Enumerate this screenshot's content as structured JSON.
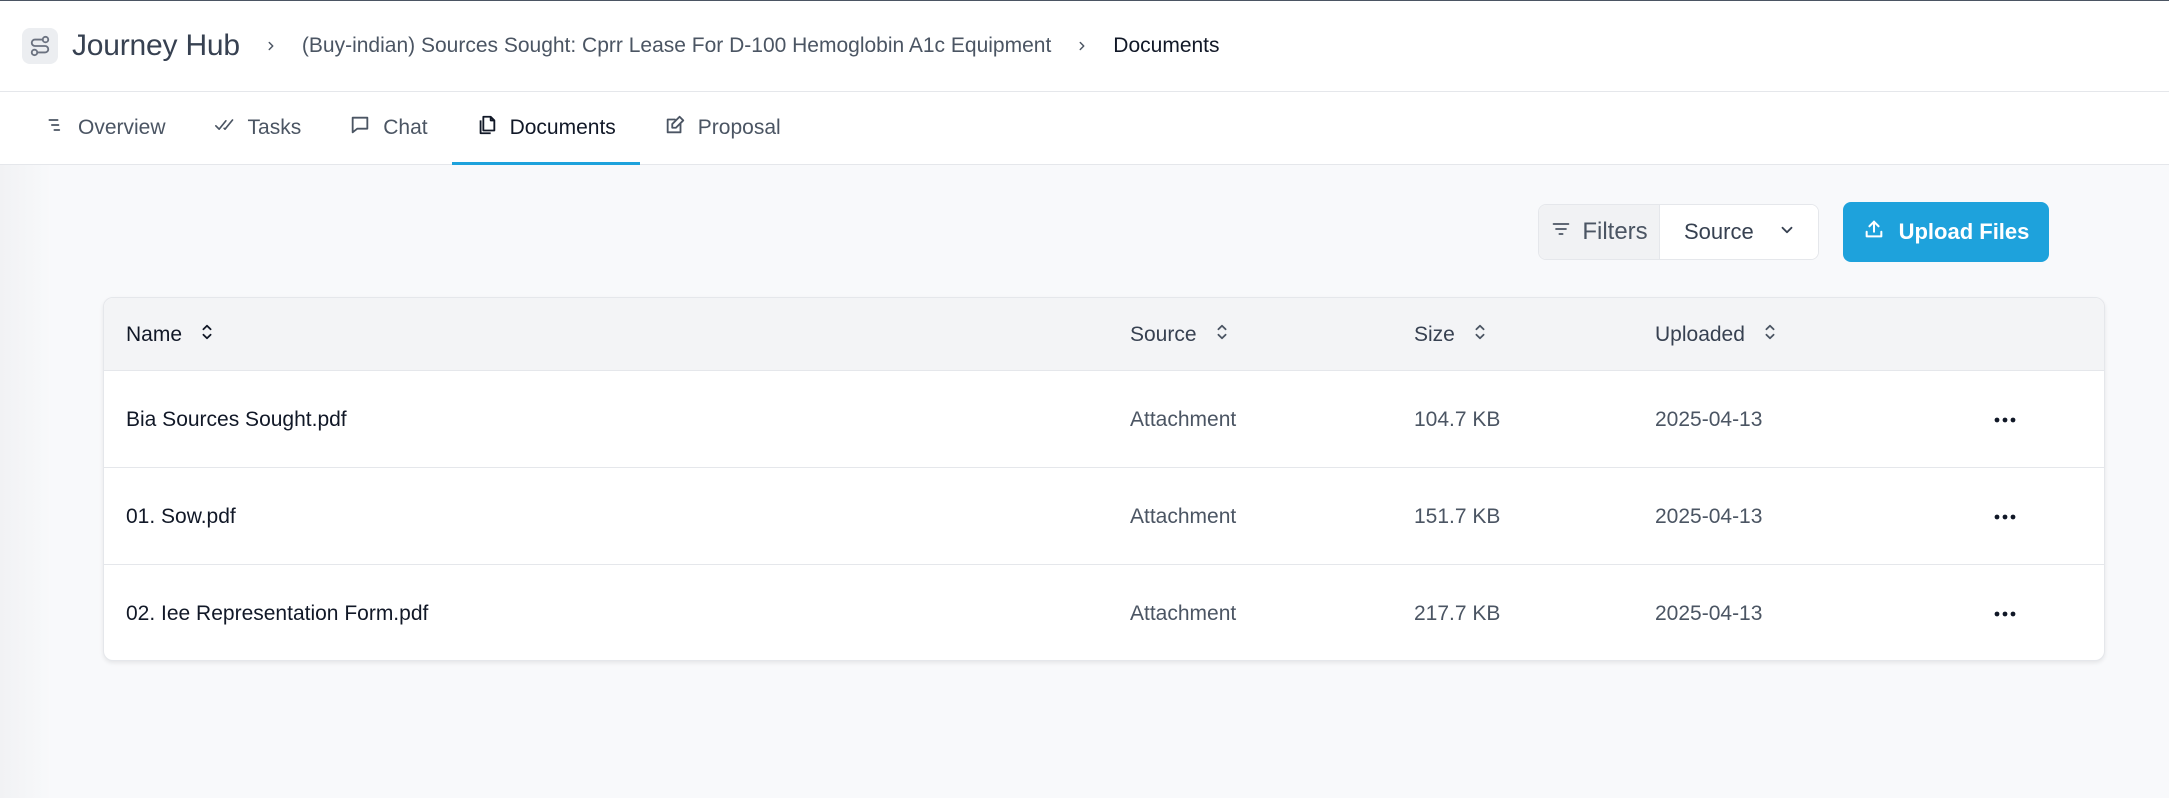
{
  "header": {
    "app_title": "Journey Hub",
    "breadcrumbs": [
      {
        "label": "(Buy-indian) Sources Sought: Cprr Lease For D-100 Hemoglobin A1c Equipment"
      },
      {
        "label": "Documents"
      }
    ]
  },
  "tabs": [
    {
      "label": "Overview",
      "icon": "list-icon"
    },
    {
      "label": "Tasks",
      "icon": "double-check-icon"
    },
    {
      "label": "Chat",
      "icon": "chat-bubble-icon"
    },
    {
      "label": "Documents",
      "icon": "documents-icon",
      "active": true
    },
    {
      "label": "Proposal",
      "icon": "edit-document-icon"
    }
  ],
  "toolbar": {
    "filters_label": "Filters",
    "source_select_value": "Source",
    "upload_label": "Upload Files"
  },
  "table": {
    "columns": [
      "Name",
      "Source",
      "Size",
      "Uploaded"
    ],
    "rows": [
      {
        "name": "Bia Sources Sought.pdf",
        "source": "Attachment",
        "size": "104.7 KB",
        "uploaded": "2025-04-13"
      },
      {
        "name": "01. Sow.pdf",
        "source": "Attachment",
        "size": "151.7 KB",
        "uploaded": "2025-04-13"
      },
      {
        "name": "02. Iee Representation Form.pdf",
        "source": "Attachment",
        "size": "217.7 KB",
        "uploaded": "2025-04-13"
      }
    ]
  },
  "colors": {
    "accent": "#1ea2dc",
    "text_primary": "#111827",
    "text_secondary": "#4b5563",
    "border": "#e5e7eb",
    "background": "#f8f9fb"
  }
}
